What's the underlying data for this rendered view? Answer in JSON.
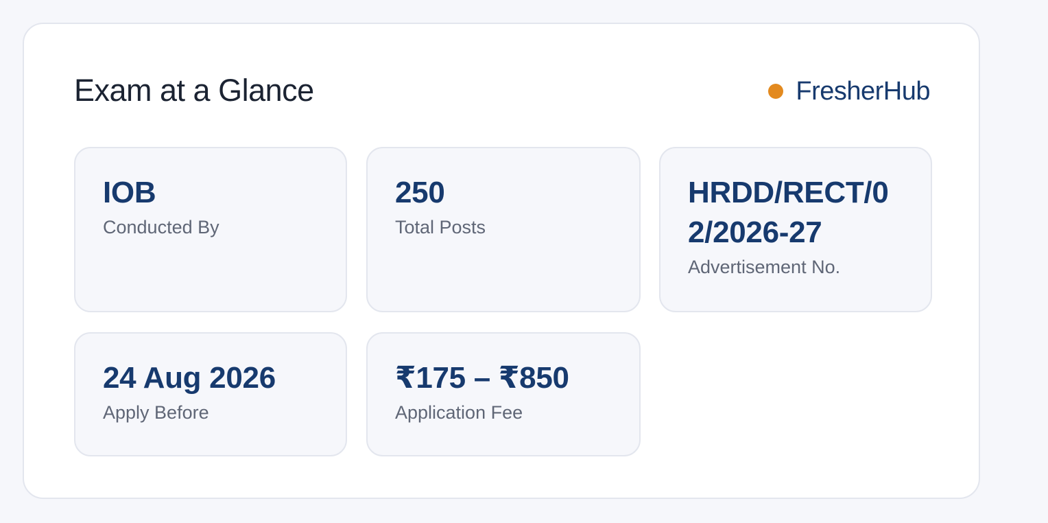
{
  "title": "Exam at a Glance",
  "brand": {
    "name": "FresherHub",
    "dot_color": "#e38a1f"
  },
  "stats": [
    {
      "value": "IOB",
      "label": "Conducted By"
    },
    {
      "value": "250",
      "label": "Total Posts"
    },
    {
      "value": "HRDD/RECT/02/2026-27",
      "label": "Advertisement No."
    },
    {
      "value": "24 Aug 2026",
      "label": "Apply Before"
    },
    {
      "value": "₹175 – ₹850",
      "label": "Application Fee"
    }
  ],
  "colors": {
    "page_background": "#f6f7fb",
    "value_text": "#173a6e",
    "label_text": "#5f6676",
    "title_text": "#1b2332"
  }
}
